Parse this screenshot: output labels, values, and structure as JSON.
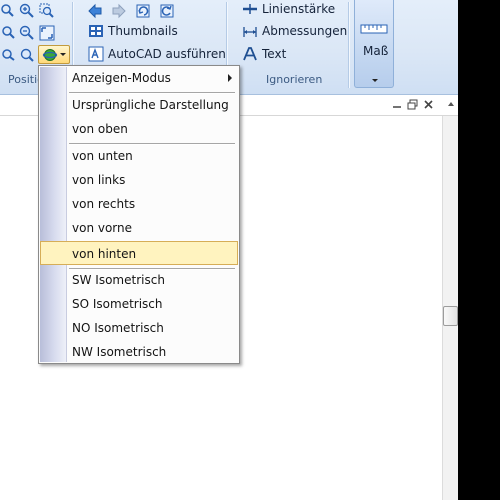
{
  "ribbon": {
    "group_position_label": "Position",
    "group_ignore_label": "Ignorieren",
    "thumbnails_label": "Thumbnails",
    "autocad_label": "AutoCAD ausführen",
    "lineweight_label": "Linienstärke",
    "dimensions_label": "Abmessungen",
    "text_label": "Text",
    "mass_label": "Maß"
  },
  "menu": {
    "items": [
      {
        "label": "Anzeigen-Modus",
        "submenu": true
      },
      {
        "label": "Ursprüngliche Darstellung"
      },
      {
        "label": "von oben"
      },
      {
        "label": "von unten"
      },
      {
        "label": "von links"
      },
      {
        "label": "von rechts"
      },
      {
        "label": "von vorne"
      },
      {
        "label": "von hinten",
        "highlighted": true
      },
      {
        "label": "SW Isometrisch"
      },
      {
        "label": "SO Isometrisch"
      },
      {
        "label": "NO Isometrisch"
      },
      {
        "label": "NW Isometrisch"
      }
    ]
  },
  "colors": {
    "highlight_bg": "#fff3bf",
    "highlight_border": "#d6ad57",
    "ribbon_bg": "#dbe7f6"
  },
  "icons": [
    "zoom-in-icon",
    "zoom-window-icon",
    "zoom-out-icon",
    "zoom-extents-icon",
    "pan-icon",
    "view-orbit-icon",
    "back-arrow-icon",
    "forward-arrow-icon",
    "restore-icon",
    "refresh-icon",
    "thumbnails-icon",
    "autocad-icon",
    "lineweight-icon",
    "dimensions-icon",
    "text-icon",
    "ruler-icon"
  ]
}
